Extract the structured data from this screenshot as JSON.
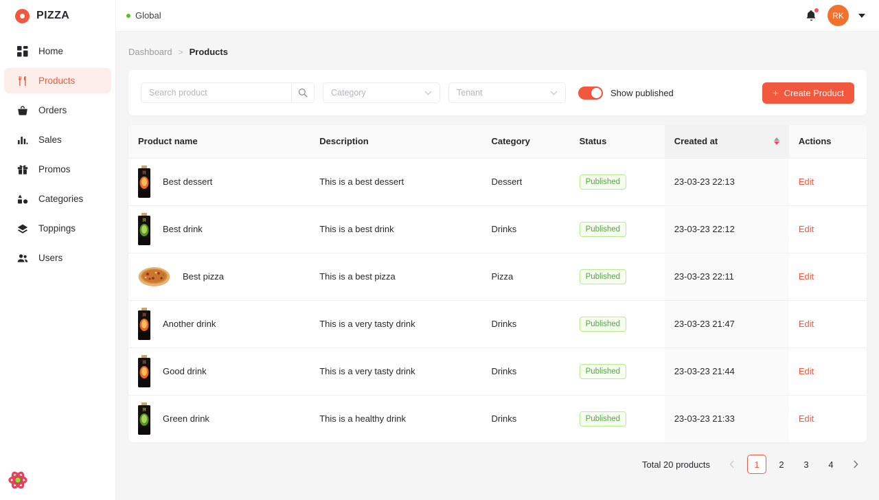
{
  "brand": {
    "name": "PIZZA",
    "logo_icon": "pizza-ring-icon",
    "accent_color": "#f2583e"
  },
  "sidebar": {
    "items": [
      {
        "label": "Home",
        "icon": "dashboard-grid-icon",
        "active": false
      },
      {
        "label": "Products",
        "icon": "fork-knife-icon",
        "active": true
      },
      {
        "label": "Orders",
        "icon": "basket-icon",
        "active": false
      },
      {
        "label": "Sales",
        "icon": "bar-chart-icon",
        "active": false
      },
      {
        "label": "Promos",
        "icon": "gift-icon",
        "active": false
      },
      {
        "label": "Categories",
        "icon": "shapes-icon",
        "active": false
      },
      {
        "label": "Toppings",
        "icon": "layers-icon",
        "active": false
      },
      {
        "label": "Users",
        "icon": "users-icon",
        "active": false
      }
    ],
    "devtools_icon": "react-atom-icon"
  },
  "topbar": {
    "tenant_label": "Global",
    "tenant_status_color": "#52c41a",
    "notification_icon": "bell-icon",
    "has_notification": true,
    "avatar_initials": "RK",
    "avatar_color": "#f2712b",
    "caret_icon": "chevron-down-icon"
  },
  "breadcrumb": {
    "parent": "Dashboard",
    "separator": ">",
    "current": "Products"
  },
  "filters": {
    "search": {
      "value": "",
      "placeholder": "Search product"
    },
    "search_icon": "search-icon",
    "category": {
      "value": "",
      "placeholder": "Category"
    },
    "tenant": {
      "value": "",
      "placeholder": "Tenant"
    },
    "toggle": {
      "label": "Show published",
      "checked": true
    },
    "create_button": {
      "label": "Create Product",
      "icon": "plus-icon"
    }
  },
  "table": {
    "columns": [
      {
        "label": "Product name",
        "key": "name"
      },
      {
        "label": "Description",
        "key": "description"
      },
      {
        "label": "Category",
        "key": "category"
      },
      {
        "label": "Status",
        "key": "status"
      },
      {
        "label": "Created at",
        "key": "created_at",
        "sorted": true,
        "sort_direction": "desc"
      },
      {
        "label": "Actions",
        "key": "actions"
      }
    ],
    "rows": [
      {
        "thumb": "bottle-orange",
        "name": "Best dessert",
        "description": "This is a best dessert",
        "category": "Dessert",
        "status": "Published",
        "created_at": "23-03-23 22:13",
        "action": "Edit"
      },
      {
        "thumb": "bottle-green",
        "name": "Best drink",
        "description": "This is a best drink",
        "category": "Drinks",
        "status": "Published",
        "created_at": "23-03-23 22:12",
        "action": "Edit"
      },
      {
        "thumb": "pizza",
        "name": "Best pizza",
        "description": "This is a best pizza",
        "category": "Pizza",
        "status": "Published",
        "created_at": "23-03-23 22:11",
        "action": "Edit"
      },
      {
        "thumb": "bottle-orange",
        "name": "Another drink",
        "description": "This is a very tasty drink",
        "category": "Drinks",
        "status": "Published",
        "created_at": "23-03-23 21:47",
        "action": "Edit"
      },
      {
        "thumb": "bottle-orange",
        "name": "Good drink",
        "description": "This is a very tasty drink",
        "category": "Drinks",
        "status": "Published",
        "created_at": "23-03-23 21:44",
        "action": "Edit"
      },
      {
        "thumb": "bottle-green",
        "name": "Green drink",
        "description": "This is a healthy drink",
        "category": "Drinks",
        "status": "Published",
        "created_at": "23-03-23 21:33",
        "action": "Edit"
      }
    ]
  },
  "pagination": {
    "total_label": "Total 20 products",
    "prev_icon": "chevron-left-icon",
    "next_icon": "chevron-right-icon",
    "pages": [
      "1",
      "2",
      "3",
      "4"
    ],
    "active_page": "1"
  }
}
